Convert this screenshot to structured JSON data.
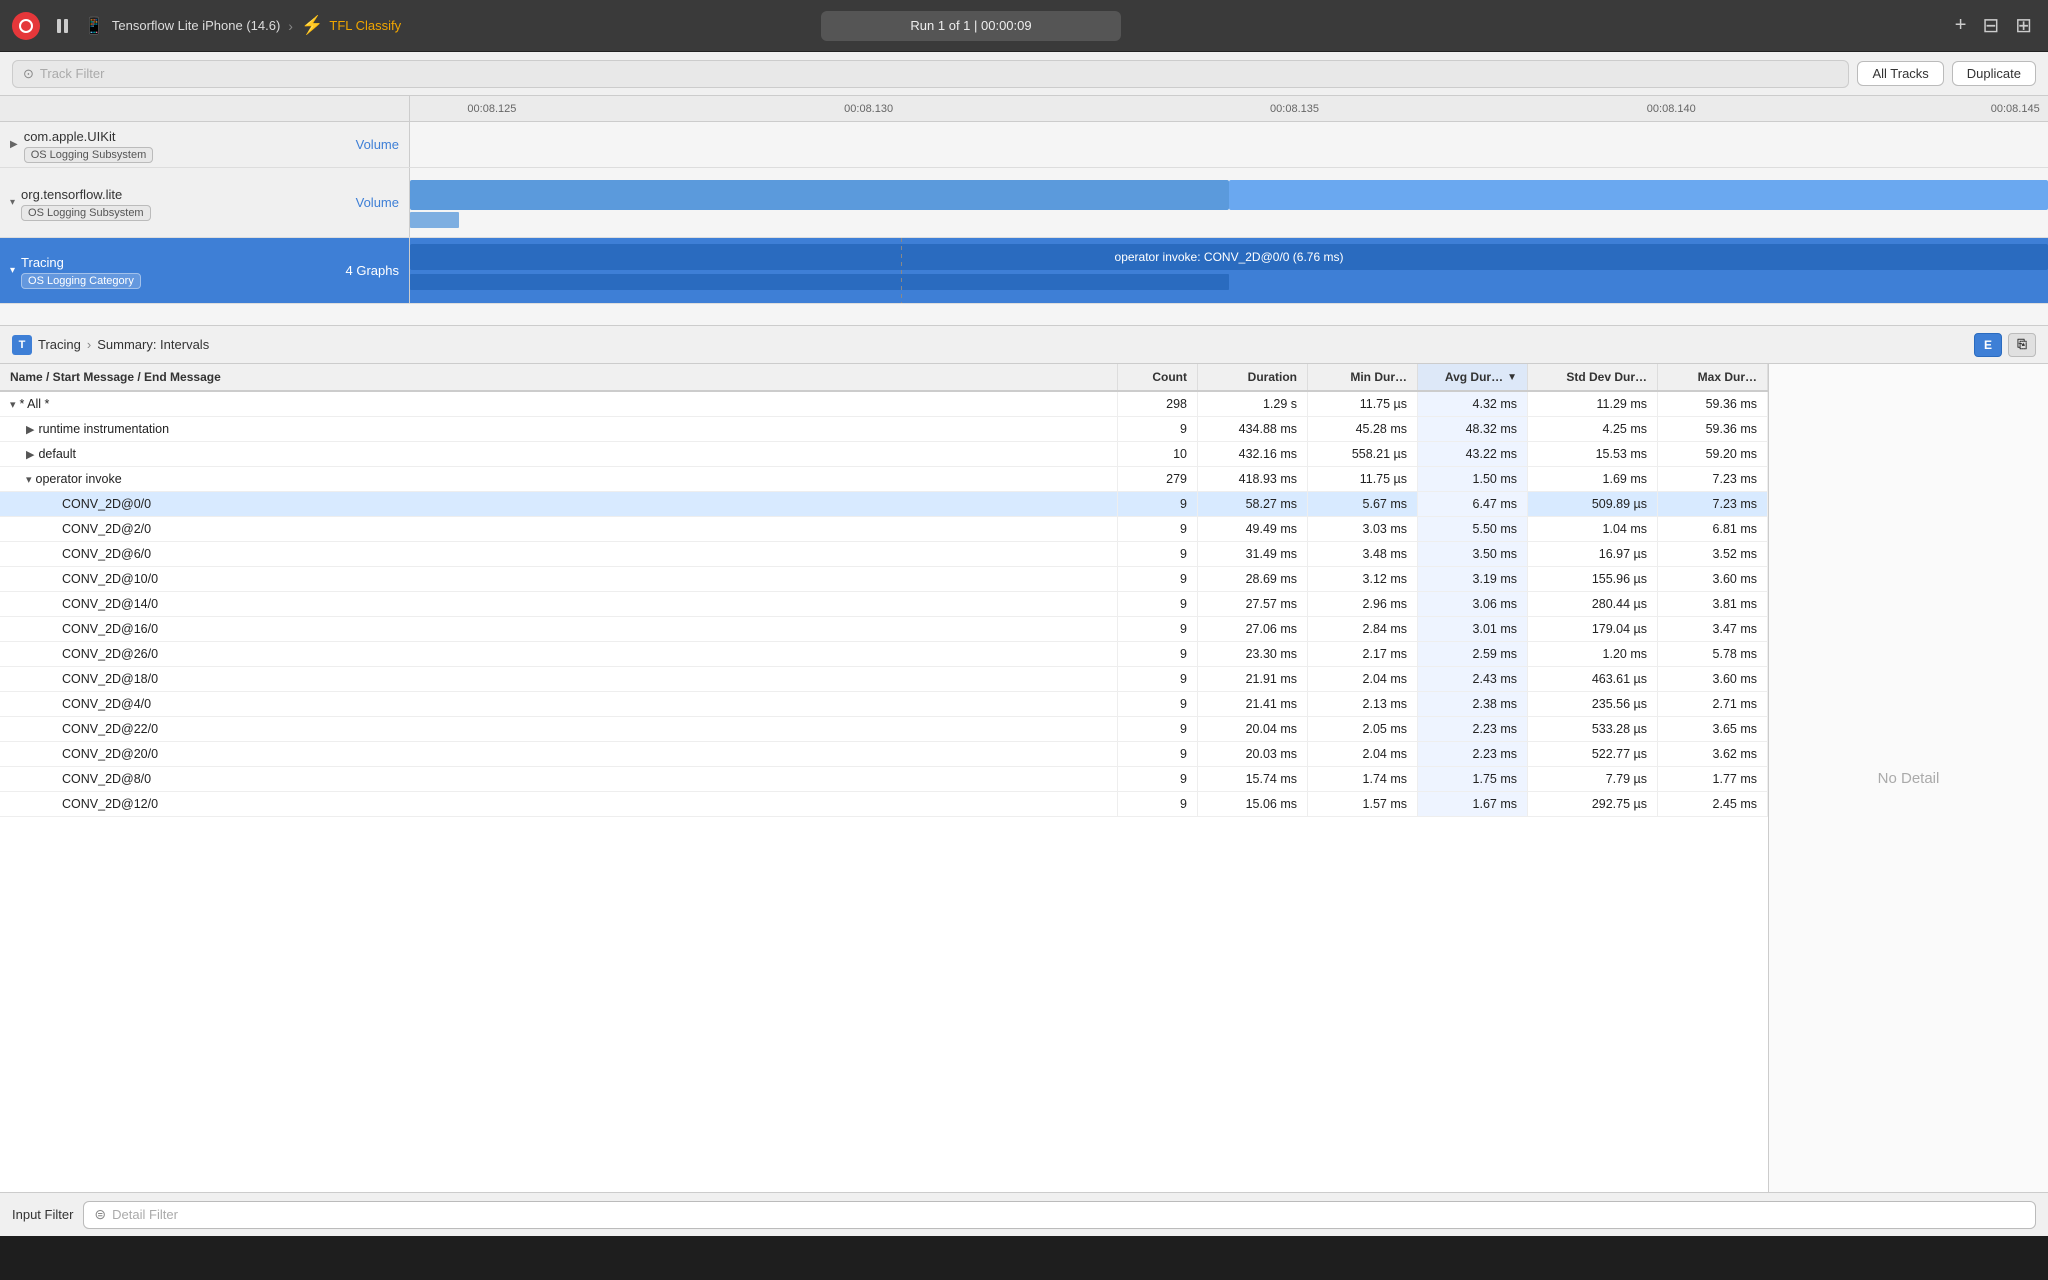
{
  "titleBar": {
    "recordLabel": "Record",
    "pauseLabel": "Pause",
    "deviceName": "Tensorflow Lite iPhone (14.6)",
    "arrow": "›",
    "appName": "TFL Classify",
    "runInfo": "Run 1 of 1  |  00:00:09",
    "addIcon": "+",
    "layoutIcon": "⊟",
    "panelIcon": "⊞"
  },
  "filterBar": {
    "trackFilterPlaceholder": "Track Filter",
    "allTracksLabel": "All Tracks",
    "duplicateLabel": "Duplicate"
  },
  "timeline": {
    "ticks": [
      {
        "label": "00:08.125",
        "pct": 5
      },
      {
        "label": "00:08.130",
        "pct": 28
      },
      {
        "label": "00:08.135",
        "pct": 54
      },
      {
        "label": "00:08.140",
        "pct": 77
      },
      {
        "label": "00:08.145",
        "pct": 99
      }
    ],
    "dashedLinePct": 30
  },
  "tracks": [
    {
      "id": "uikit",
      "collapsed": true,
      "name": "com.apple.UIKit",
      "badge": "OS Logging Subsystem",
      "hasVolume": true,
      "volumeLabel": "Volume"
    },
    {
      "id": "tensorflow",
      "collapsed": false,
      "name": "org.tensorflow.lite",
      "badge": "OS Logging Subsystem",
      "hasVolume": true,
      "volumeLabel": "Volume"
    },
    {
      "id": "tracing",
      "active": true,
      "name": "Tracing",
      "badge": "OS Logging Category",
      "graphsLabel": "4 Graphs",
      "overlayLabel": "operator invoke: CONV_2D@0/0 (6.76 ms)"
    }
  ],
  "breadcrumb": {
    "icon": "T",
    "parent": "Tracing",
    "sep": "›",
    "current": "Summary: Intervals",
    "exportLabel": "E",
    "docLabel": "⎘"
  },
  "table": {
    "headers": [
      {
        "id": "name",
        "label": "Name / Start Message / End Message"
      },
      {
        "id": "count",
        "label": "Count"
      },
      {
        "id": "duration",
        "label": "Duration"
      },
      {
        "id": "minDur",
        "label": "Min Dur…"
      },
      {
        "id": "avgDur",
        "label": "Avg Dur…",
        "sorted": true,
        "sortDir": "desc"
      },
      {
        "id": "stdDev",
        "label": "Std Dev Dur…"
      },
      {
        "id": "maxDur",
        "label": "Max Dur…"
      }
    ],
    "rows": [
      {
        "id": "all",
        "indent": 0,
        "toggle": "▾",
        "name": "* All *",
        "count": "298",
        "duration": "1.29 s",
        "minDur": "11.75 µs",
        "avgDur": "4.32 ms",
        "stdDev": "11.29 ms",
        "maxDur": "59.36 ms",
        "selected": false
      },
      {
        "id": "runtime",
        "indent": 1,
        "toggle": "▶",
        "name": "runtime instrumentation",
        "count": "9",
        "duration": "434.88 ms",
        "minDur": "45.28 ms",
        "avgDur": "48.32 ms",
        "stdDev": "4.25 ms",
        "maxDur": "59.36 ms"
      },
      {
        "id": "default",
        "indent": 1,
        "toggle": "▶",
        "name": "default",
        "count": "10",
        "duration": "432.16 ms",
        "minDur": "558.21 µs",
        "avgDur": "43.22 ms",
        "stdDev": "15.53 ms",
        "maxDur": "59.20 ms"
      },
      {
        "id": "opinvoke",
        "indent": 1,
        "toggle": "▾",
        "name": "operator invoke",
        "count": "279",
        "duration": "418.93 ms",
        "minDur": "11.75 µs",
        "avgDur": "1.50 ms",
        "stdDev": "1.69 ms",
        "maxDur": "7.23 ms"
      },
      {
        "id": "conv0",
        "indent": 2,
        "toggle": "",
        "name": "CONV_2D@0/0",
        "count": "9",
        "duration": "58.27 ms",
        "minDur": "5.67 ms",
        "avgDur": "6.47 ms",
        "stdDev": "509.89 µs",
        "maxDur": "7.23 ms",
        "highlighted": true
      },
      {
        "id": "conv2",
        "indent": 2,
        "toggle": "",
        "name": "CONV_2D@2/0",
        "count": "9",
        "duration": "49.49 ms",
        "minDur": "3.03 ms",
        "avgDur": "5.50 ms",
        "stdDev": "1.04 ms",
        "maxDur": "6.81 ms"
      },
      {
        "id": "conv6",
        "indent": 2,
        "toggle": "",
        "name": "CONV_2D@6/0",
        "count": "9",
        "duration": "31.49 ms",
        "minDur": "3.48 ms",
        "avgDur": "3.50 ms",
        "stdDev": "16.97 µs",
        "maxDur": "3.52 ms"
      },
      {
        "id": "conv10",
        "indent": 2,
        "toggle": "",
        "name": "CONV_2D@10/0",
        "count": "9",
        "duration": "28.69 ms",
        "minDur": "3.12 ms",
        "avgDur": "3.19 ms",
        "stdDev": "155.96 µs",
        "maxDur": "3.60 ms"
      },
      {
        "id": "conv14",
        "indent": 2,
        "toggle": "",
        "name": "CONV_2D@14/0",
        "count": "9",
        "duration": "27.57 ms",
        "minDur": "2.96 ms",
        "avgDur": "3.06 ms",
        "stdDev": "280.44 µs",
        "maxDur": "3.81 ms"
      },
      {
        "id": "conv16",
        "indent": 2,
        "toggle": "",
        "name": "CONV_2D@16/0",
        "count": "9",
        "duration": "27.06 ms",
        "minDur": "2.84 ms",
        "avgDur": "3.01 ms",
        "stdDev": "179.04 µs",
        "maxDur": "3.47 ms"
      },
      {
        "id": "conv26",
        "indent": 2,
        "toggle": "",
        "name": "CONV_2D@26/0",
        "count": "9",
        "duration": "23.30 ms",
        "minDur": "2.17 ms",
        "avgDur": "2.59 ms",
        "stdDev": "1.20 ms",
        "maxDur": "5.78 ms"
      },
      {
        "id": "conv18",
        "indent": 2,
        "toggle": "",
        "name": "CONV_2D@18/0",
        "count": "9",
        "duration": "21.91 ms",
        "minDur": "2.04 ms",
        "avgDur": "2.43 ms",
        "stdDev": "463.61 µs",
        "maxDur": "3.60 ms"
      },
      {
        "id": "conv4",
        "indent": 2,
        "toggle": "",
        "name": "CONV_2D@4/0",
        "count": "9",
        "duration": "21.41 ms",
        "minDur": "2.13 ms",
        "avgDur": "2.38 ms",
        "stdDev": "235.56 µs",
        "maxDur": "2.71 ms"
      },
      {
        "id": "conv22",
        "indent": 2,
        "toggle": "",
        "name": "CONV_2D@22/0",
        "count": "9",
        "duration": "20.04 ms",
        "minDur": "2.05 ms",
        "avgDur": "2.23 ms",
        "stdDev": "533.28 µs",
        "maxDur": "3.65 ms"
      },
      {
        "id": "conv20",
        "indent": 2,
        "toggle": "",
        "name": "CONV_2D@20/0",
        "count": "9",
        "duration": "20.03 ms",
        "minDur": "2.04 ms",
        "avgDur": "2.23 ms",
        "stdDev": "522.77 µs",
        "maxDur": "3.62 ms"
      },
      {
        "id": "conv8",
        "indent": 2,
        "toggle": "",
        "name": "CONV_2D@8/0",
        "count": "9",
        "duration": "15.74 ms",
        "minDur": "1.74 ms",
        "avgDur": "1.75 ms",
        "stdDev": "7.79 µs",
        "maxDur": "1.77 ms"
      },
      {
        "id": "conv12",
        "indent": 2,
        "toggle": "",
        "name": "CONV_2D@12/0",
        "count": "9",
        "duration": "15.06 ms",
        "minDur": "1.57 ms",
        "avgDur": "1.67 ms",
        "stdDev": "292.75 µs",
        "maxDur": "2.45 ms"
      }
    ]
  },
  "detailPanel": {
    "noDetailLabel": "No Detail"
  },
  "inputFilter": {
    "label": "Input Filter",
    "detailPlaceholder": "Detail Filter",
    "filterIcon": "⊜"
  }
}
